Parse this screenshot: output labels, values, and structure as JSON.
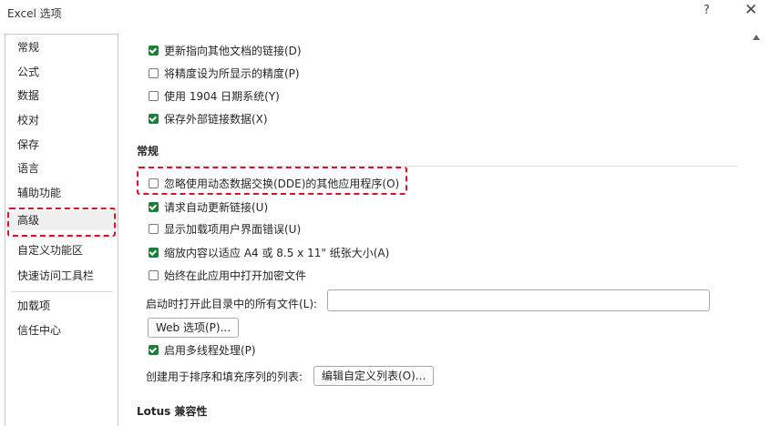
{
  "window": {
    "title": "Excel 选项",
    "help_label": "?",
    "close_label": "✕"
  },
  "nav": {
    "items": [
      {
        "label": "常规"
      },
      {
        "label": "公式"
      },
      {
        "label": "数据"
      },
      {
        "label": "校对"
      },
      {
        "label": "保存"
      },
      {
        "label": "语言"
      },
      {
        "label": "辅助功能"
      },
      {
        "label": "高级",
        "selected": true
      },
      {
        "label": "自定义功能区"
      },
      {
        "label": "快速访问工具栏"
      },
      {
        "label": "加载项"
      },
      {
        "label": "信任中心"
      }
    ]
  },
  "content": {
    "top_options": [
      {
        "label": "更新指向其他文档的链接(D)",
        "checked": true
      },
      {
        "label": "将精度设为所显示的精度(P)",
        "checked": false
      },
      {
        "label": "使用 1904 日期系统(Y)",
        "checked": false
      },
      {
        "label": "保存外部链接数据(X)",
        "checked": true
      }
    ],
    "general": {
      "heading": "常规",
      "options": [
        {
          "label": "忽略使用动态数据交换(DDE)的其他应用程序(O)",
          "checked": false
        },
        {
          "label": "请求自动更新链接(U)",
          "checked": true
        },
        {
          "label": "显示加载项用户界面错误(U)",
          "checked": false
        },
        {
          "label": "缩放内容以适应 A4 或 8.5 x 11\" 纸张大小(A)",
          "checked": true
        },
        {
          "label": "始终在此应用中打开加密文件",
          "checked": false
        }
      ],
      "startup_label": "启动时打开此目录中的所有文件(L):",
      "startup_value": "",
      "web_options_button": "Web 选项(P)...",
      "multithread_label": "启用多线程处理(P)",
      "multithread_checked": true,
      "custom_lists_label": "创建用于排序和填充序列的列表:",
      "custom_lists_button": "编辑自定义列表(O)..."
    },
    "lotus": {
      "heading": "Lotus 兼容性"
    }
  },
  "colors": {
    "accent_check": "#1a7f37",
    "highlight": "#d7122c"
  }
}
